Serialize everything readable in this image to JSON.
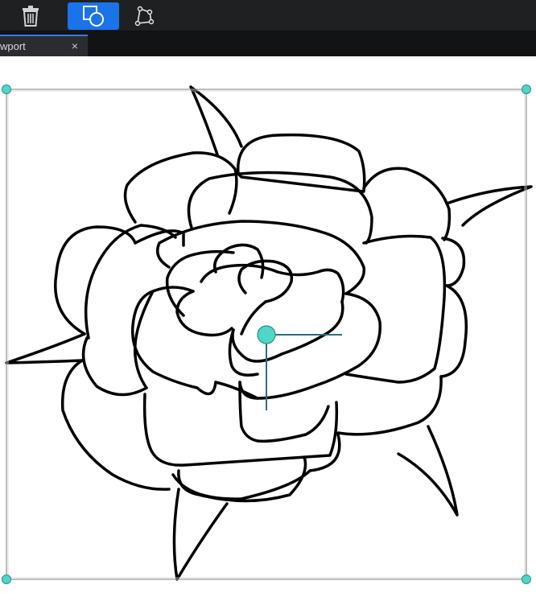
{
  "toolbar": {
    "tools": [
      {
        "id": "delete",
        "icon": "trash-icon",
        "active": false
      },
      {
        "id": "shapes",
        "icon": "shapes-icon",
        "active": true
      },
      {
        "id": "path",
        "icon": "vector-path-icon",
        "active": false
      }
    ],
    "accent_color": "#1a73e8"
  },
  "tabs": [
    {
      "label": "wport",
      "close_glyph": "×"
    }
  ],
  "canvas": {
    "background": "#ffffff",
    "selection_handle_color": "#4fd6c8",
    "gizmo_color": "#2f6e78",
    "drawing": "rose-line-art"
  }
}
